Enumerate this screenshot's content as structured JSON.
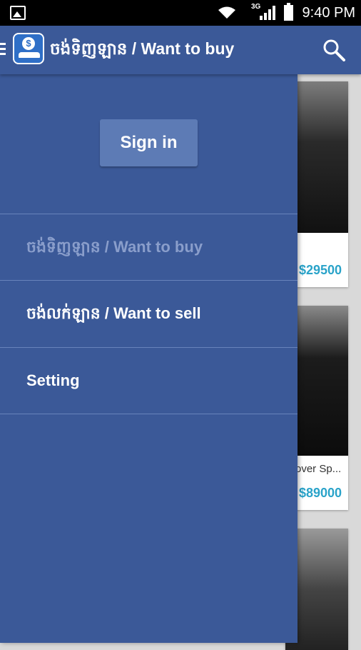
{
  "status_bar": {
    "network_label": "3G",
    "time": "9:40 PM",
    "icons": [
      "gallery-icon",
      "wifi-icon",
      "signal-icon",
      "battery-icon"
    ]
  },
  "app_bar": {
    "title": "ចង់ទិញឡាន / Want to buy",
    "icons": [
      "menu-icon",
      "app-logo-icon",
      "search-icon"
    ]
  },
  "drawer": {
    "sign_in_label": "Sign in",
    "items": [
      {
        "label": "ចង់ទិញឡាន / Want to buy",
        "state": "selected"
      },
      {
        "label": "ចង់លក់ឡាន / Want to sell",
        "state": "normal"
      },
      {
        "label": "Setting",
        "state": "normal"
      }
    ]
  },
  "listings": [
    {
      "name": "",
      "price": "$29500"
    },
    {
      "name": "over Sp...",
      "price": "$89000"
    },
    {
      "name": "",
      "price": ""
    }
  ],
  "colors": {
    "primary": "#3b5998",
    "button": "#5d7bb5",
    "price": "#2aa3c9",
    "disabled_text": "#8a9ecb"
  }
}
